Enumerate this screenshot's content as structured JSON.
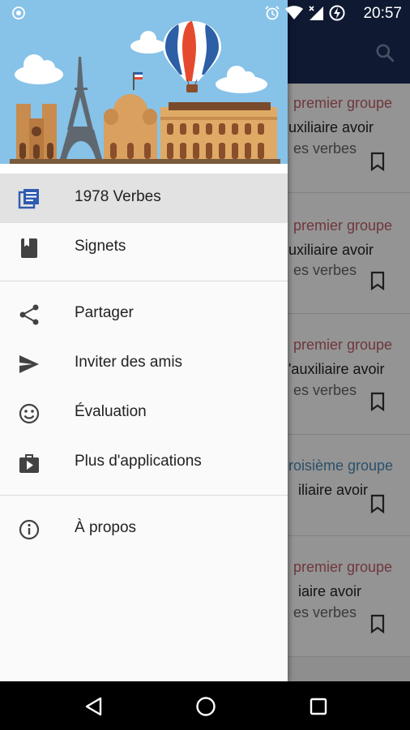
{
  "status_bar": {
    "time": "20:57",
    "icons": [
      "target-icon",
      "alarm-icon",
      "wifi-icon",
      "signal-icon",
      "battery-charging-icon"
    ]
  },
  "background": {
    "appbar_color": "#1a2b57",
    "cards": [
      {
        "group": "premier groupe",
        "aux": "uxiliaire avoir",
        "desc": "es verbes"
      },
      {
        "group": "premier groupe",
        "aux": "uxiliaire avoir",
        "desc": "es verbes"
      },
      {
        "group": "premier groupe",
        "aux": "'auxiliaire avoir",
        "desc": "es verbes"
      },
      {
        "group": "roisième groupe",
        "aux": "iliaire avoir",
        "desc": ""
      },
      {
        "group": "premier groupe",
        "aux": "iaire avoir",
        "desc": "es verbes"
      }
    ]
  },
  "drawer": {
    "menu_primary": [
      {
        "label": "1978 Verbes",
        "icon": "list-icon",
        "active": true
      },
      {
        "label": "Signets",
        "icon": "bookmark-book-icon",
        "active": false
      }
    ],
    "menu_secondary": [
      {
        "label": "Partager",
        "icon": "share-icon"
      },
      {
        "label": "Inviter des amis",
        "icon": "send-icon"
      },
      {
        "label": "Évaluation",
        "icon": "smiley-icon"
      },
      {
        "label": "Plus d'applications",
        "icon": "store-icon"
      }
    ],
    "menu_tertiary": [
      {
        "label": "À propos",
        "icon": "info-icon"
      }
    ]
  },
  "colors": {
    "active_icon": "#2f5bb0",
    "group_red": "#c0606a",
    "group_blue": "#4a8ab8",
    "sky": "#87c2e8"
  }
}
